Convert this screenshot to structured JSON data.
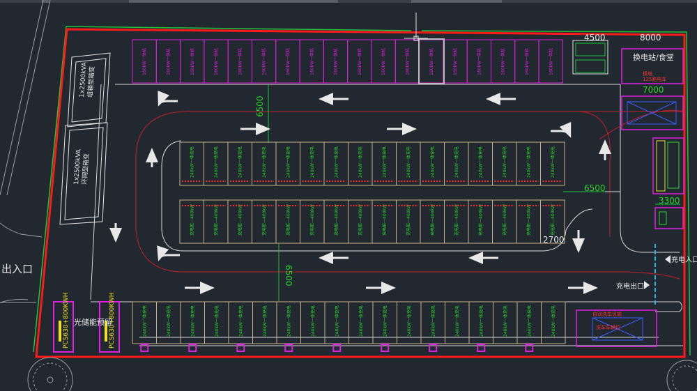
{
  "colors": {
    "background": "#212830",
    "site_boundary": "#ff1a1a",
    "outer_boundary": "#22c43a",
    "magenta": "#e020e0",
    "green_text": "#2bd42b",
    "white": "#e8e8e8",
    "tan": "#c9b48a",
    "cyan": "#22b8e0",
    "yellow": "#f0e020",
    "blue": "#3a5cff"
  },
  "labels": {
    "entrance_exit": "出入口",
    "charging_entrance": "充电入口",
    "charging_exit": "充电出口",
    "swap_station": "换电站/食堂",
    "swap_sub": "换电",
    "swap_sub2": "125路电车",
    "storage_reserve": "光储能预留",
    "auto_wash": "自动洗车设施",
    "auto_wash_sub": "洗车车辆位",
    "transformer_1": "1x2500kVA",
    "transformer_1_sub": "组箱型箱变",
    "transformer_2": "1x2500kVA",
    "transformer_2_sub": "环网型箱变",
    "pcs_1": "PCS630+800KWH",
    "pcs_2": "PCS630+800KWH"
  },
  "dimensions": {
    "d4500": "4500",
    "d8000": "8000",
    "d7000": "7000",
    "d6500_a": "6500",
    "d6500_b": "6500",
    "d6500_c": "6500",
    "d3300": "3300",
    "d2700": "2700"
  },
  "slot_labels": {
    "top_row": "160kW一体机",
    "row_a": "240kW一体充电",
    "row_b": "充电桩—400kW",
    "row_c": "240kW一体充电"
  },
  "icons": {
    "arrow": "direction-arrow-icon",
    "flag": "direction-flag-icon",
    "charger": "charger-unit-icon",
    "tree": "tree-icon"
  }
}
